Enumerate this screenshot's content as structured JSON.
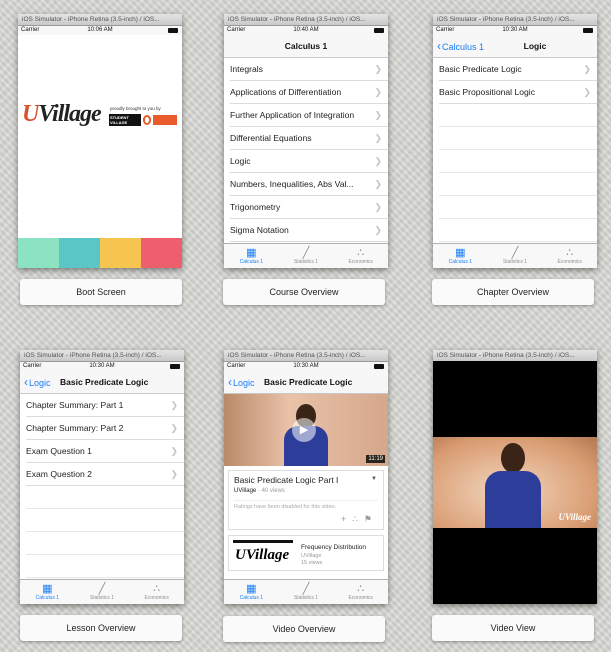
{
  "common": {
    "sim_title": "iOS Simulator - iPhone Retina (3.5-inch) / iOS...",
    "carrier": "Carrier",
    "tabs": [
      "Calculus 1",
      "Statistics 1",
      "Economics"
    ]
  },
  "boot": {
    "time": "10:06 AM",
    "logo_u": "U",
    "logo_rest": "Village",
    "brought_by": "proudly brought to you by",
    "student_village": "STUDENT VILLAGE",
    "stripe_colors": [
      "#8be3c2",
      "#5bc6c6",
      "#f5c550",
      "#ee5f6d"
    ],
    "caption": "Boot Screen"
  },
  "course": {
    "time": "10:40 AM",
    "title": "Calculus 1",
    "items": [
      "Integrals",
      "Applications of Differentiation",
      "Further Application of Integration",
      "Differential Equations",
      "Logic",
      "Numbers, Inequalities, Abs Val...",
      "Trigonometry",
      "Sigma Notation"
    ],
    "caption": "Course Overview"
  },
  "chapter": {
    "time": "10:30 AM",
    "back": "Calculus 1",
    "title": "Logic",
    "items": [
      "Basic Predicate Logic",
      "Basic Propositional Logic"
    ],
    "caption": "Chapter Overview"
  },
  "lesson": {
    "time": "10:30 AM",
    "back": "Logic",
    "title": "Basic Predicate Logic",
    "items": [
      "Chapter Summary: Part 1",
      "Chapter Summary: Part 2",
      "Exam Question 1",
      "Exam Question 2"
    ],
    "caption": "Lesson Overview"
  },
  "video": {
    "time": "10:30 AM",
    "back": "Logic",
    "title": "Basic Predicate Logic",
    "duration": "11:19",
    "video_title": "Basic Predicate Logic Part I",
    "channel": "UVillage",
    "views": "· 40 views",
    "ratings_note": "Ratings have been disabled for this video.",
    "related_title": "Frequency Distribution",
    "related_channel": "UVillage",
    "related_views": "15 views",
    "related_logo": "UVillage",
    "caption": "Video Overview"
  },
  "videoview": {
    "watermark": "UVillage",
    "caption": "Video View"
  },
  "accent_color": "#1a7ef5"
}
